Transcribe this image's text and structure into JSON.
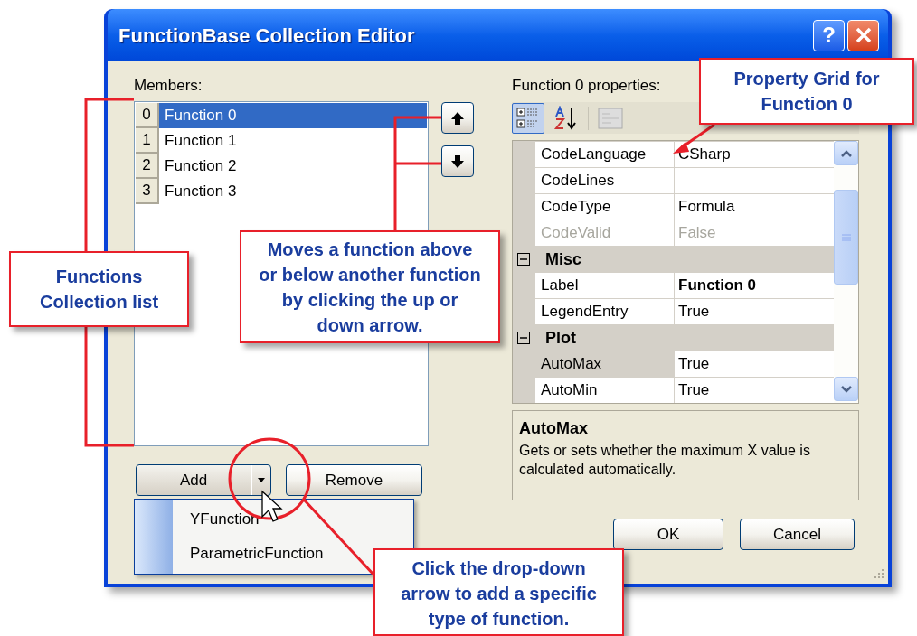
{
  "window": {
    "title": "FunctionBase Collection Editor",
    "help_label": "?"
  },
  "members": {
    "label": "Members:",
    "items": [
      {
        "index": "0",
        "name": "Function 0",
        "selected": true
      },
      {
        "index": "1",
        "name": "Function 1",
        "selected": false
      },
      {
        "index": "2",
        "name": "Function 2",
        "selected": false
      },
      {
        "index": "3",
        "name": "Function 3",
        "selected": false
      }
    ]
  },
  "add_button": {
    "label": "Add"
  },
  "remove_button": {
    "label": "Remove"
  },
  "add_menu": {
    "items": [
      "YFunction",
      "ParametricFunction"
    ]
  },
  "properties": {
    "label": "Function 0 properties:",
    "toolbar": [
      {
        "kind": "categorized",
        "selected": true,
        "disabled": false
      },
      {
        "kind": "alphabetical",
        "selected": false,
        "disabled": false
      },
      {
        "kind": "pages",
        "selected": false,
        "disabled": true
      }
    ],
    "rows": [
      {
        "kind": "property",
        "name": "CodeLanguage",
        "value": "CSharp",
        "selected": false,
        "disabled": false,
        "modified": false
      },
      {
        "kind": "property",
        "name": "CodeLines",
        "selected": false,
        "disabled": false
      },
      {
        "kind": "property",
        "name": "CodeType",
        "value": "Formula",
        "selected": false,
        "disabled": false,
        "modified": false
      },
      {
        "kind": "property",
        "name": "CodeValid",
        "value": "False",
        "selected": false,
        "disabled": true,
        "modified": false
      },
      {
        "kind": "category",
        "name": "Misc",
        "expanded": true
      },
      {
        "kind": "property",
        "name": "Label",
        "value": "Function 0",
        "selected": false,
        "disabled": false,
        "modified": true
      },
      {
        "kind": "property",
        "name": "LegendEntry",
        "value": "True",
        "selected": false,
        "disabled": false,
        "modified": false
      },
      {
        "kind": "category",
        "name": "Plot",
        "expanded": true
      },
      {
        "kind": "property",
        "name": "AutoMax",
        "value": "True",
        "selected": true,
        "disabled": false,
        "modified": false
      },
      {
        "kind": "property",
        "name": "AutoMin",
        "value": "True",
        "selected": false,
        "disabled": false,
        "modified": false
      }
    ]
  },
  "description": {
    "title": "AutoMax",
    "text": "Gets or sets whether the maximum X value is calculated automatically."
  },
  "dialog_buttons": [
    "OK",
    "Cancel"
  ],
  "callouts": [
    {
      "text": "Property Grid for Function 0"
    },
    {
      "text": "Functions Collection list"
    },
    {
      "text": "Moves a function above or below another function by clicking the up or down arrow."
    },
    {
      "text": "Click the drop-down arrow to add a specific type of function."
    }
  ]
}
